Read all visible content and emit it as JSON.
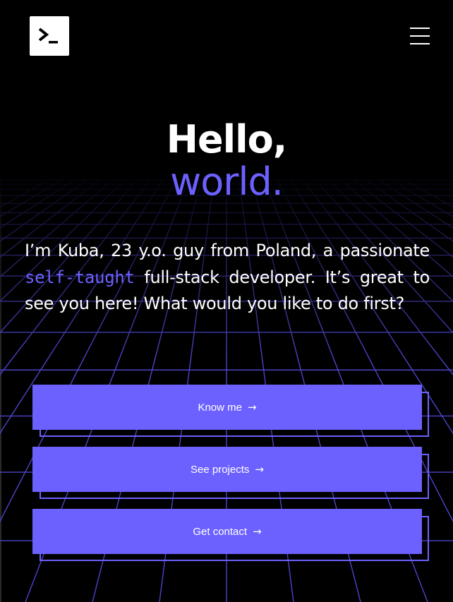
{
  "header": {
    "logo_icon": "terminal-prompt-icon",
    "menu_icon": "hamburger-menu-icon"
  },
  "hero": {
    "title_line1": "Hello,",
    "title_line2": "world."
  },
  "intro": {
    "text_before": "I’m Kuba, 23 y.o. guy from Poland, a passionate ",
    "accent": "self-taught",
    "text_after": " full-stack developer. It’s great to see you here! What would you like to do first?"
  },
  "actions": {
    "know_me": "Know me",
    "see_projects": "See projects",
    "get_contact": "Get contact",
    "arrow_icon": "arrow-right-icon",
    "arrow_glyph": "→"
  },
  "colors": {
    "background": "#000000",
    "accent": "#6c61ff",
    "grid_line": "#4b44c9",
    "text": "#ffffff"
  }
}
